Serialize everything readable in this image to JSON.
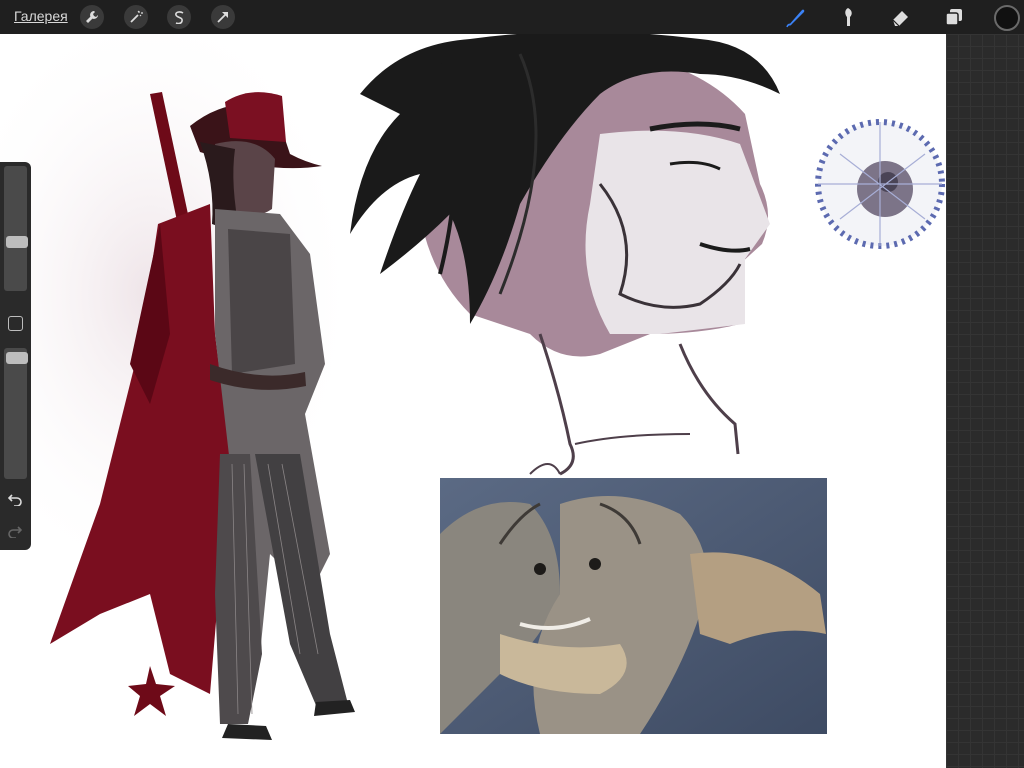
{
  "topbar": {
    "gallery_label": "Галерея",
    "left_tools": [
      {
        "name": "wrench-icon"
      },
      {
        "name": "magic-wand-icon"
      },
      {
        "name": "selection-icon"
      },
      {
        "name": "transform-arrow-icon"
      }
    ],
    "right_tools": [
      {
        "name": "brush-icon",
        "active_color": "#3b82f6"
      },
      {
        "name": "smudge-icon"
      },
      {
        "name": "eraser-icon"
      },
      {
        "name": "layers-icon"
      }
    ],
    "current_color": "#111111"
  },
  "sidebar": {
    "brush_size_level": 0.58,
    "opacity_level": 1.0
  }
}
